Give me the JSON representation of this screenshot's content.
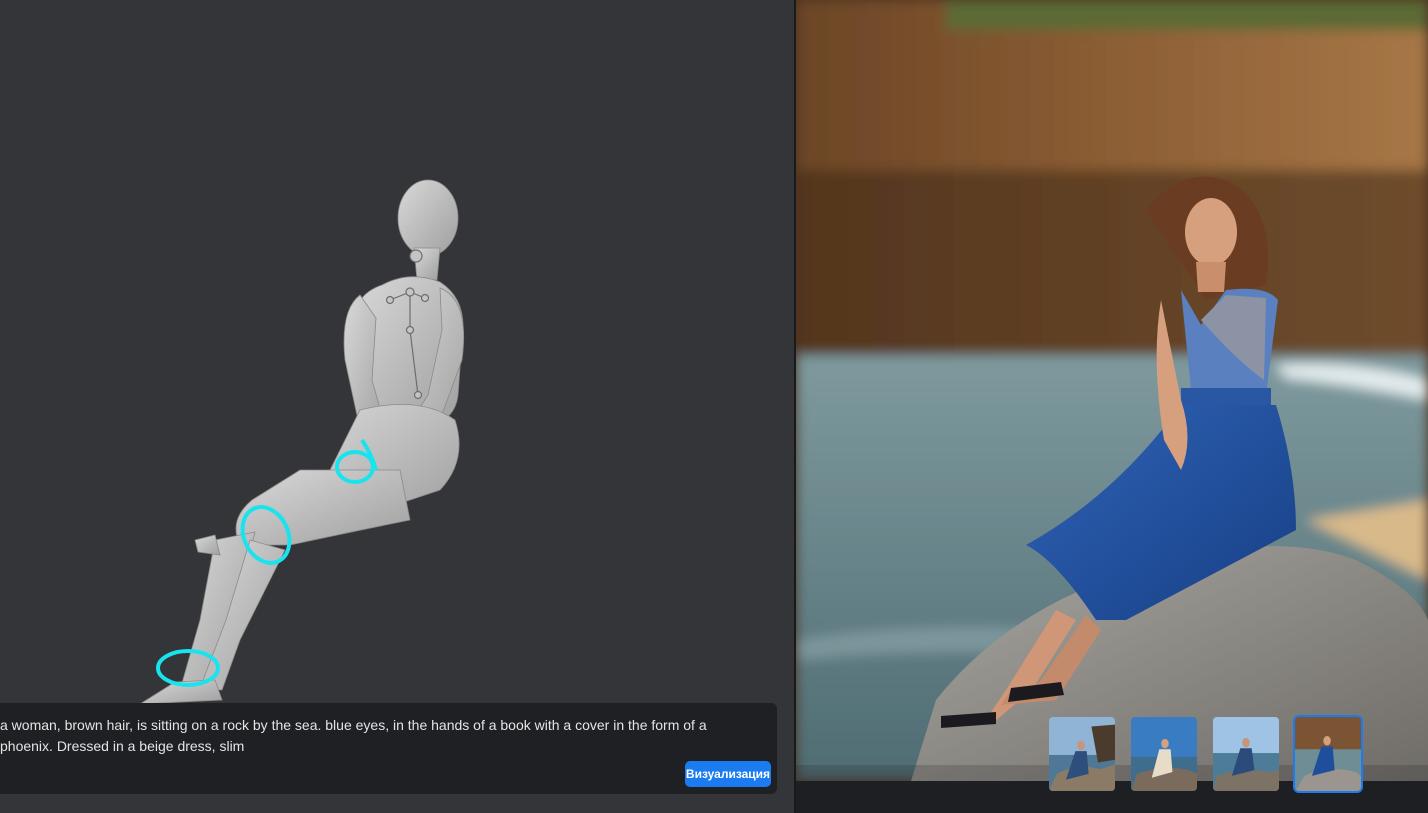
{
  "prompt": {
    "text": "a woman, brown hair, is sitting on a rock by the sea. blue eyes, in the hands of a book with a cover in the form of a\nphoenix. Dressed in a beige dress, slim"
  },
  "visualize_button": {
    "label": "Визуализация"
  },
  "thumbnails": [
    {
      "selected": false
    },
    {
      "selected": false
    },
    {
      "selected": false
    },
    {
      "selected": true
    }
  ],
  "colors": {
    "accent": "#1a7cf0",
    "pose_handle": "#19e3ee",
    "viewport_bg": "#343538",
    "prompt_bg": "#1f2023"
  }
}
